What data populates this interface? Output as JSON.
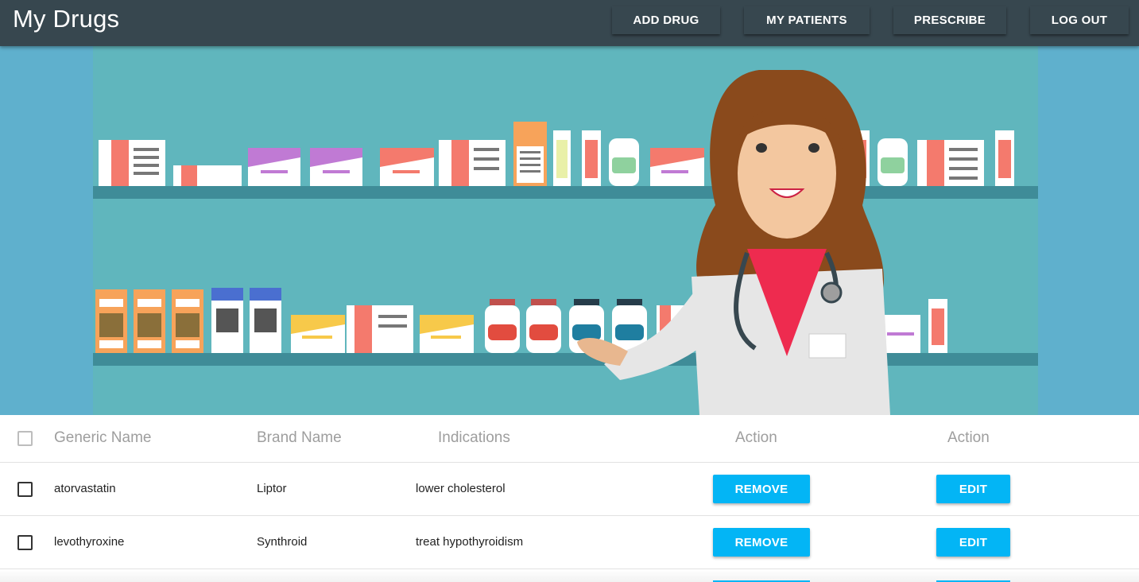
{
  "app": {
    "title": "My Drugs"
  },
  "nav": {
    "add_drug": "ADD DRUG",
    "my_patients": "MY PATIENTS",
    "prescribe": "PRESCRIBE",
    "log_out": "LOG OUT"
  },
  "colors": {
    "appbar": "#37474f",
    "accent_button": "#03b5f5",
    "hero_background": "#5fb0cd",
    "header_text": "#9e9e9e"
  },
  "table": {
    "headers": {
      "generic": "Generic Name",
      "brand": "Brand Name",
      "indications": "Indications",
      "action1": "Action",
      "action2": "Action"
    },
    "rows": [
      {
        "generic": "atorvastatin",
        "brand": "Liptor",
        "indications": "lower cholesterol",
        "remove": "REMOVE",
        "edit": "EDIT"
      },
      {
        "generic": "levothyroxine",
        "brand": "Synthroid",
        "indications": "treat hypothyroidism",
        "remove": "REMOVE",
        "edit": "EDIT"
      }
    ]
  }
}
